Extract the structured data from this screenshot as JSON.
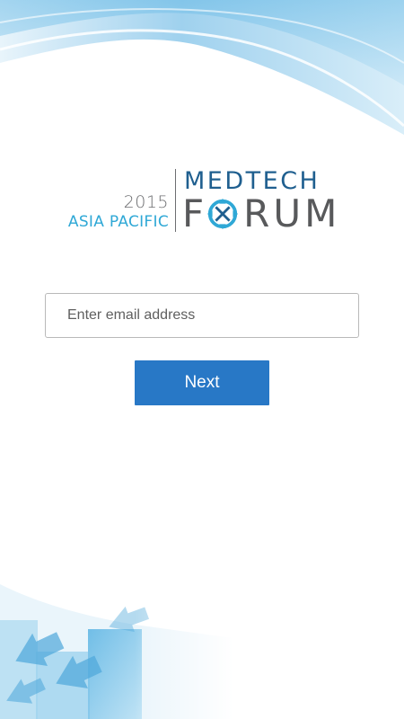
{
  "logo": {
    "year": "2015",
    "region": "ASIA PACIFIC",
    "brand_top": "MEDTECH",
    "brand_bottom_first": "F",
    "brand_bottom_rest": "RUM",
    "colors": {
      "year": "#6d6e71",
      "region": "#2fa8d6",
      "brand_top": "#1f5f8f",
      "brand_bottom": "#58595b"
    }
  },
  "form": {
    "email_placeholder": "Enter email address",
    "email_value": "",
    "next_label": "Next",
    "accent_color": "#2878c6"
  },
  "decor": {
    "top_graphic": "blue-swoosh-background",
    "bottom_graphic": "blue-arrows-cubes-background"
  }
}
